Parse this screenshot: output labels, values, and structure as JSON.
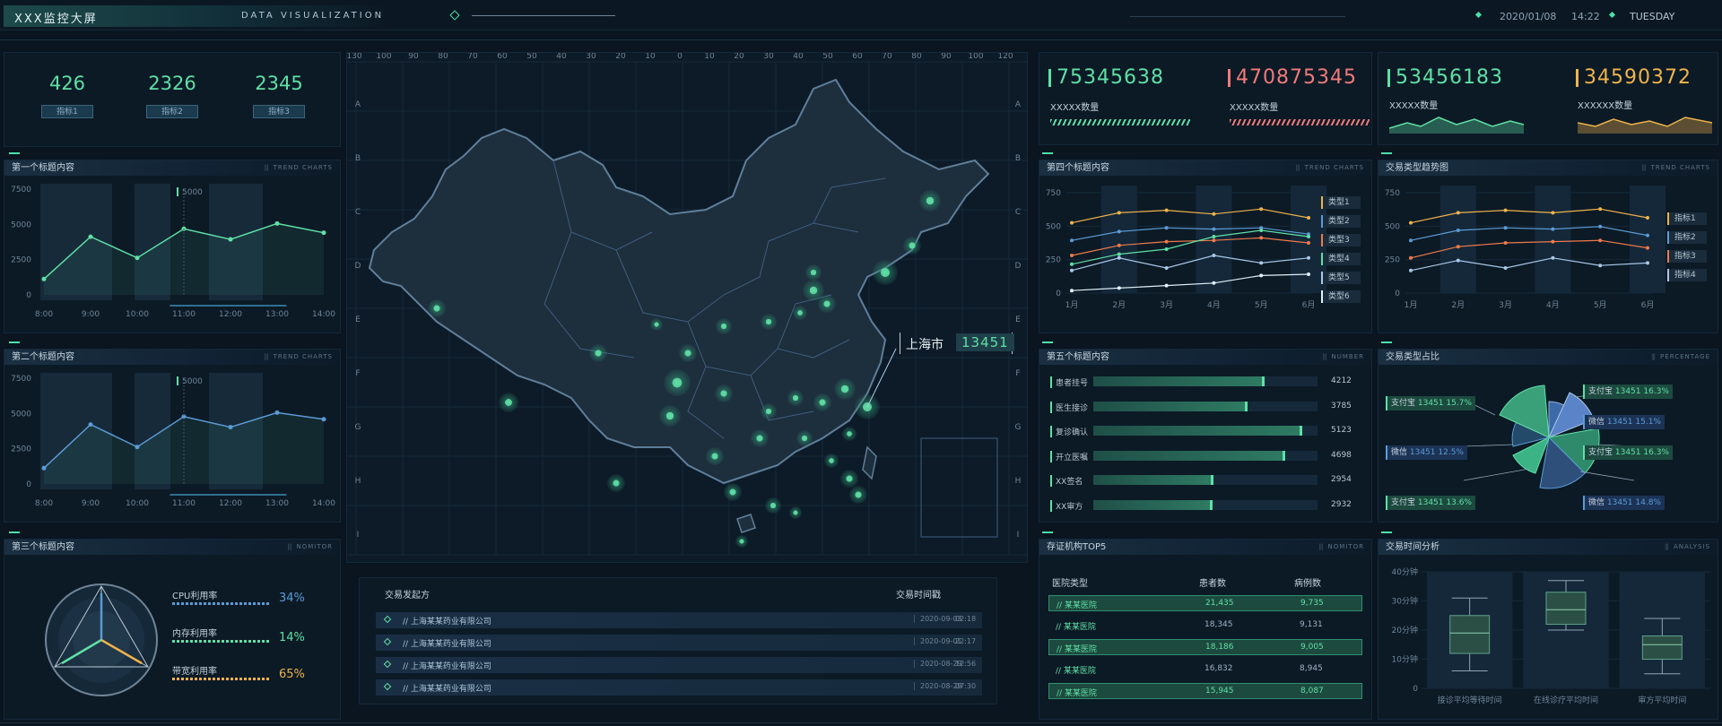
{
  "header": {
    "title": "XXX监控大屏",
    "subtitle": "DATA VISUALIZATION",
    "date": "2020/01/08",
    "time": "14:22",
    "weekday": "TUESDAY"
  },
  "kpis": [
    {
      "value": "426",
      "label": "指标1"
    },
    {
      "value": "2326",
      "label": "指标2"
    },
    {
      "value": "2345",
      "label": "指标3"
    }
  ],
  "panel1": {
    "title": "第一个标题内容",
    "en": "TREND CHARTS",
    "marker": "5000",
    "chart_data": {
      "type": "line",
      "categories": [
        "8:00",
        "9:00",
        "10:00",
        "11:00",
        "12:00",
        "13:00",
        "14:00"
      ],
      "values": [
        1200,
        4400,
        2800,
        5000,
        4200,
        5400,
        4700
      ],
      "yticks": [
        "7500",
        "5000",
        "2500",
        "0"
      ],
      "ylim": [
        0,
        8000
      ]
    }
  },
  "panel2": {
    "title": "第二个标题内容",
    "en": "TREND CHARTS",
    "marker": "5000",
    "chart_data": {
      "type": "line",
      "categories": [
        "8:00",
        "9:00",
        "10:00",
        "11:00",
        "12:00",
        "13:00",
        "14:00"
      ],
      "values": [
        1200,
        4500,
        2800,
        5100,
        4300,
        5400,
        4900
      ],
      "yticks": [
        "7500",
        "5000",
        "2500",
        "0"
      ],
      "ylim": [
        0,
        8000
      ]
    }
  },
  "panel3": {
    "title": "第三个标题内容",
    "en": "NOMITOR",
    "metrics": [
      {
        "label": "CPU利用率",
        "value": "34%",
        "color": "#5b9bd5"
      },
      {
        "label": "内存利用率",
        "value": "14%",
        "color": "#5fe0a5"
      },
      {
        "label": "带宽利用率",
        "value": "65%",
        "color": "#f0b34a"
      }
    ]
  },
  "map": {
    "top_ticks": [
      "130",
      "100",
      "90",
      "80",
      "70",
      "60",
      "50",
      "40",
      "30",
      "20",
      "10",
      "0",
      "10",
      "20",
      "30",
      "40",
      "50",
      "60",
      "70",
      "80",
      "90",
      "100",
      "120"
    ],
    "side_letters": [
      "A",
      "B",
      "C",
      "D",
      "E",
      "F",
      "G",
      "H",
      "I"
    ],
    "callout_city": "上海市",
    "callout_value": "13451"
  },
  "transactions": {
    "col1": "交易发起方",
    "col2": "交易时间戳",
    "rows": [
      {
        "name": "// 上海某某药业有限公司",
        "date": "2020-09-03",
        "time": "02:18"
      },
      {
        "name": "// 上海某某药业有限公司",
        "date": "2020-09-01",
        "time": "22:17"
      },
      {
        "name": "// 上海某某药业有限公司",
        "date": "2020-08-29",
        "time": "12:56"
      },
      {
        "name": "// 上海某某药业有限公司",
        "date": "2020-08-29",
        "time": "07:30"
      }
    ]
  },
  "stats": [
    {
      "value": "75345638",
      "label": "XXXXX数量",
      "color": "#5fe0a5"
    },
    {
      "value": "470875345",
      "label": "XXXXX数量",
      "color": "#f07a7a"
    },
    {
      "value": "53456183",
      "label": "XXXXX数量",
      "color": "#5fe0a5"
    },
    {
      "value": "34590372",
      "label": "XXXXXX数量",
      "color": "#f0b34a"
    }
  ],
  "panel4": {
    "title": "第四个标题内容",
    "en": "TREND CHARTS",
    "chart_data": {
      "type": "line",
      "categories": [
        "1月",
        "2月",
        "3月",
        "4月",
        "5月",
        "6月"
      ],
      "yticks": [
        "750",
        "500",
        "250",
        "0"
      ],
      "ylim": [
        0,
        800
      ],
      "series": [
        {
          "name": "类型1",
          "color": "#f0b34a",
          "values": [
            560,
            640,
            660,
            630,
            670,
            600
          ]
        },
        {
          "name": "类型2",
          "color": "#5b9bd5",
          "values": [
            420,
            490,
            520,
            510,
            520,
            470
          ]
        },
        {
          "name": "类型3",
          "color": "#f07a4a",
          "values": [
            300,
            380,
            410,
            420,
            440,
            400
          ]
        },
        {
          "name": "类型4",
          "color": "#5fe0a5",
          "values": [
            230,
            310,
            350,
            450,
            500,
            450
          ]
        },
        {
          "name": "类型5",
          "color": "#a9c8e8",
          "values": [
            180,
            280,
            200,
            300,
            240,
            280
          ]
        },
        {
          "name": "类型6",
          "color": "#e0f0f8",
          "values": [
            20,
            40,
            60,
            80,
            140,
            150
          ]
        }
      ]
    }
  },
  "panel5": {
    "title": "第五个标题内容",
    "en": "NUMBER",
    "chart_data": {
      "type": "bar",
      "categories": [
        "患者挂号",
        "医生接诊",
        "复诊确认",
        "开立医嘱",
        "XX签名",
        "XX审方"
      ],
      "values": [
        4212,
        3785,
        5123,
        4698,
        2954,
        2932
      ],
      "xlim": [
        0,
        5500
      ]
    }
  },
  "panel6": {
    "title": "存证机构TOP5",
    "en": "NOMITOR",
    "headers": [
      "医院类型",
      "患者数",
      "病例数"
    ],
    "rows": [
      {
        "name": "// 某某医院",
        "patients": "21,435",
        "cases": "9,735",
        "hl": true
      },
      {
        "name": "// 某某医院",
        "patients": "18,345",
        "cases": "9,131",
        "hl": false
      },
      {
        "name": "// 某某医院",
        "patients": "18,186",
        "cases": "9,005",
        "hl": true
      },
      {
        "name": "// 某某医院",
        "patients": "16,832",
        "cases": "8,945",
        "hl": false
      },
      {
        "name": "// 某某医院",
        "patients": "15,945",
        "cases": "8,087",
        "hl": true
      }
    ]
  },
  "panel7": {
    "title": "交易类型趋势图",
    "en": "TREND CHARTS",
    "chart_data": {
      "type": "line",
      "categories": [
        "1月",
        "2月",
        "3月",
        "4月",
        "5月",
        "6月"
      ],
      "yticks": [
        "750",
        "500",
        "250",
        "0"
      ],
      "ylim": [
        0,
        800
      ],
      "series": [
        {
          "name": "指标1",
          "color": "#f0b34a",
          "values": [
            560,
            640,
            660,
            640,
            670,
            600
          ]
        },
        {
          "name": "指标2",
          "color": "#5b9bd5",
          "values": [
            420,
            500,
            520,
            510,
            530,
            460
          ]
        },
        {
          "name": "指标3",
          "color": "#f07a4a",
          "values": [
            280,
            370,
            400,
            410,
            420,
            360
          ]
        },
        {
          "name": "指标4",
          "color": "#a9c8e8",
          "values": [
            180,
            260,
            200,
            280,
            220,
            240
          ]
        }
      ]
    }
  },
  "panel8": {
    "title": "交易类型占比",
    "en": "PERCENTAGE",
    "tags": [
      {
        "name": "支付宝",
        "value": "13451",
        "pct": "15.7%",
        "color": "#5fe0a5"
      },
      {
        "name": "微信",
        "value": "13451",
        "pct": "12.5%",
        "color": "#5b9bd5"
      },
      {
        "name": "支付宝",
        "value": "13451",
        "pct": "13.6%",
        "color": "#5fe0a5"
      },
      {
        "name": "支付宝",
        "value": "13451",
        "pct": "16.3%",
        "color": "#5fe0a5"
      },
      {
        "name": "微信",
        "value": "13451",
        "pct": "15.1%",
        "color": "#5b9bd5"
      },
      {
        "name": "支付宝",
        "value": "13451",
        "pct": "16.3%",
        "color": "#5fe0a5"
      },
      {
        "name": "微信",
        "value": "13451",
        "pct": "14.8%",
        "color": "#5b9bd5"
      }
    ]
  },
  "panel9": {
    "title": "交易时间分析",
    "en": "ANALYSIS",
    "chart_data": {
      "type": "box",
      "categories": [
        "接诊平均等待时间",
        "在线诊疗平均时间",
        "审方平均时间"
      ],
      "yticks": [
        "40分钟",
        "30分钟",
        "20分钟",
        "10分钟",
        "0"
      ],
      "ylim": [
        0,
        40
      ],
      "boxes": [
        {
          "min": 6,
          "q1": 12,
          "median": 19,
          "q3": 25,
          "max": 31
        },
        {
          "min": 20,
          "q1": 22,
          "median": 27,
          "q3": 33,
          "max": 37
        },
        {
          "min": 5,
          "q1": 10,
          "median": 15,
          "q3": 18,
          "max": 24
        }
      ]
    }
  }
}
